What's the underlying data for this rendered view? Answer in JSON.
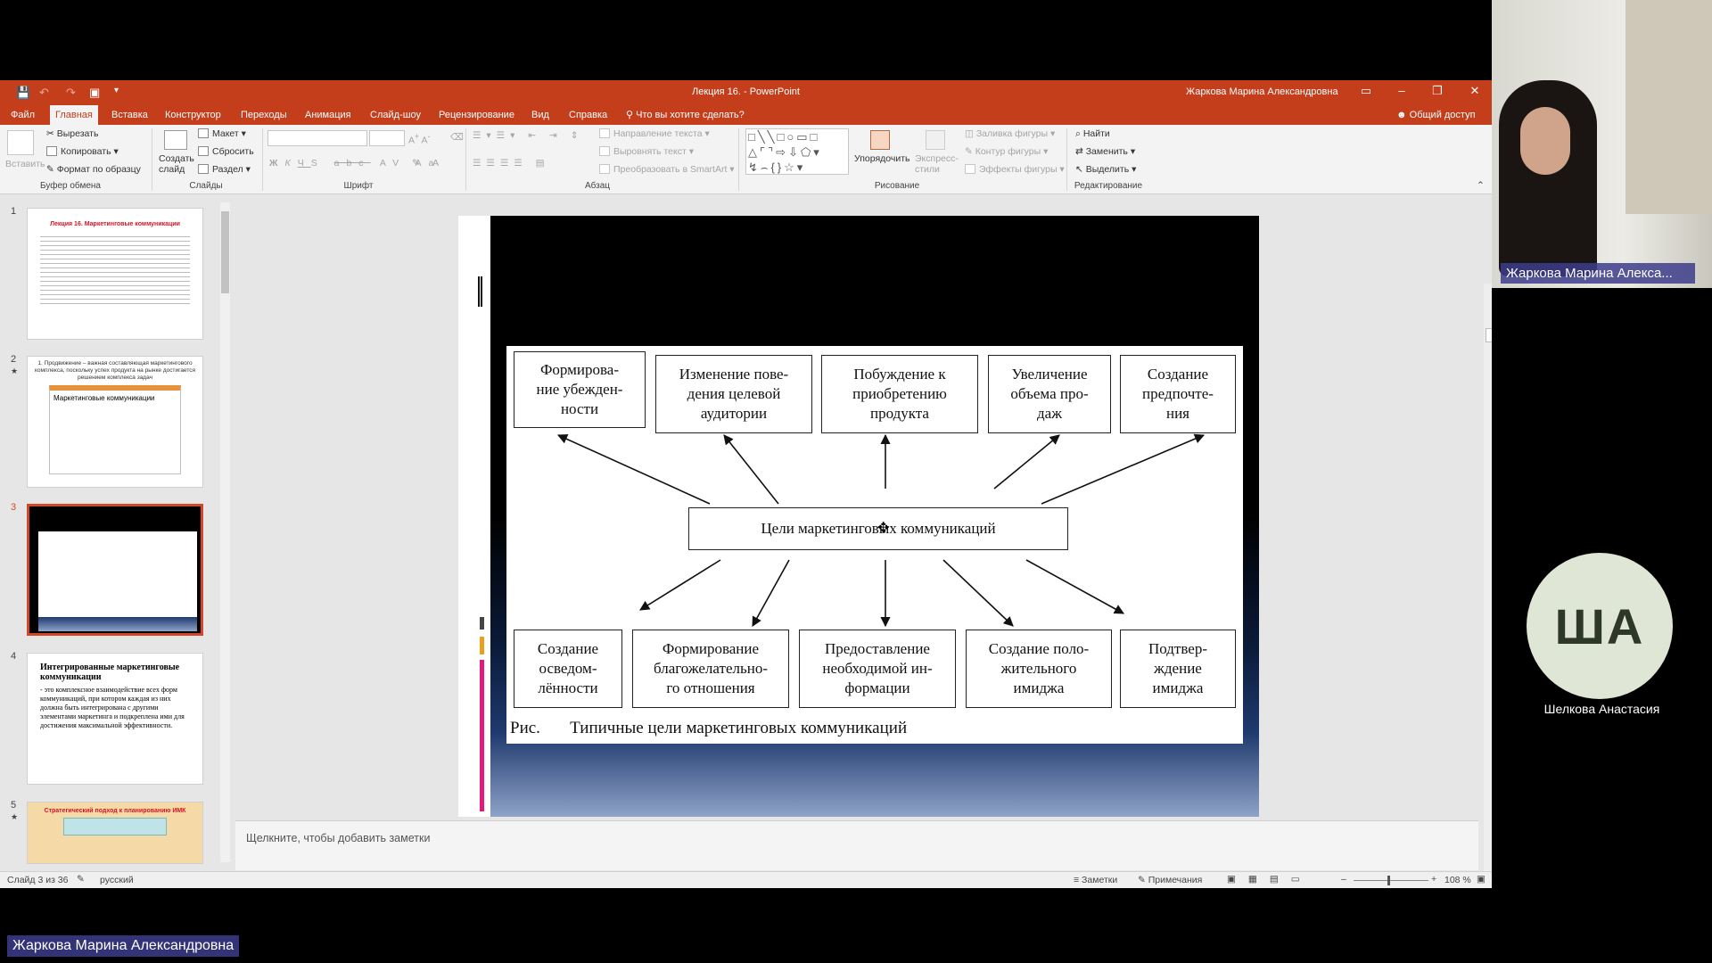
{
  "window": {
    "title": "Лекция 16. - PowerPoint",
    "user": "Жаркова Марина Александровна"
  },
  "tabs": [
    "Файл",
    "Главная",
    "Вставка",
    "Конструктор",
    "Переходы",
    "Анимация",
    "Слайд-шоу",
    "Рецензирование",
    "Вид",
    "Справка"
  ],
  "tell_me": "Что вы хотите сделать?",
  "share": "Общий доступ",
  "ribbon": {
    "clipboard": {
      "paste": "Вставить",
      "cut": "Вырезать",
      "copy": "Копировать",
      "format": "Формат по образцу",
      "label": "Буфер обмена"
    },
    "slides": {
      "new": "Создать слайд",
      "layout": "Макет",
      "reset": "Сбросить",
      "section": "Раздел",
      "label": "Слайды"
    },
    "font": {
      "label": "Шрифт"
    },
    "paragraph": {
      "direction": "Направление текста",
      "align": "Выровнять текст",
      "smartart": "Преобразовать в SmartArt",
      "label": "Абзац"
    },
    "drawing": {
      "arrange": "Упорядочить",
      "styles": "Экспресс-стили",
      "fill": "Заливка фигуры",
      "outline": "Контур фигуры",
      "effects": "Эффекты фигуры",
      "label": "Рисование"
    },
    "editing": {
      "find": "Найти",
      "replace": "Заменить",
      "select": "Выделить",
      "label": "Редактирование"
    }
  },
  "thumbnails": [
    {
      "num": "1",
      "title": "Лекция 16. Маркетинговые коммуникации"
    },
    {
      "num": "2",
      "title": "1. Продвижение – важная составляющая маркетингового комплекса, поскольку успех продукта на рынке достигается решением комплекса задач",
      "sub": "Маркетинговые коммуникации"
    },
    {
      "num": "3"
    },
    {
      "num": "4",
      "title": "Интегрированные маркетинговые коммуникации",
      "body": "- это комплексное взаимодействие всех форм коммуникаций, при котором каждая из них должна быть интегрирована с другими элементами маркетинга и подкреплена ими для достижения максимальной эффективности."
    },
    {
      "num": "5",
      "title": "Стратегический подход к планированию ИМК"
    }
  ],
  "slide": {
    "center": "Цели маркетинговых коммуникаций",
    "top_boxes": [
      "Формирова-\nние убежден-\nности",
      "Изменение пове-\nдения целевой\nаудитории",
      "Побуждение к\nприобретению\nпродукта",
      "Увеличение\nобъема про-\nдаж",
      "Создание\nпредпочте-\nния"
    ],
    "bottom_boxes": [
      "Создание\nосведом-\nлённости",
      "Формирование\nблагожелательно-\nго отношения",
      "Предоставление\nнеобходимой ин-\nформации",
      "Создание поло-\nжительного\nимиджа",
      "Подтвер-\nждение\nимиджа"
    ],
    "caption": "Рис.       Типичные цели маркетинговых коммуникаций"
  },
  "notes_placeholder": "Щелкните, чтобы добавить заметки",
  "status": {
    "slide": "Слайд 3 из 36",
    "lang": "русский",
    "notes": "Заметки",
    "comments": "Примечания",
    "zoom": "108 %"
  },
  "participants": {
    "presenter_label": "Жаркова Марина Алекса...",
    "second_initials": "ША",
    "second_name": "Шелкова Анастасия",
    "bottom_name": "Жаркова Марина Александровна"
  },
  "colors": {
    "accent": "#c43e1c",
    "selected_thumb": "#d24726"
  }
}
